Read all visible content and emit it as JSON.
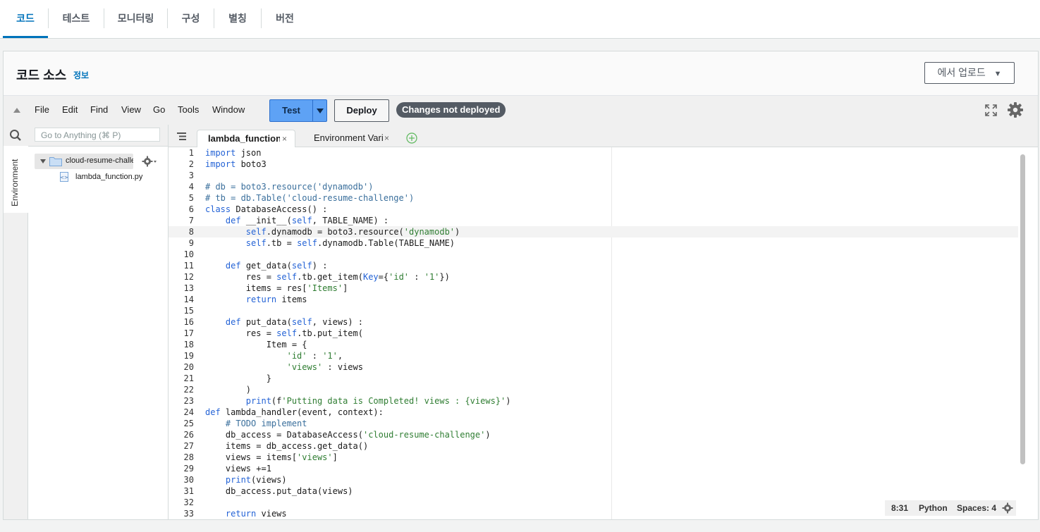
{
  "tabs": [
    "코드",
    "테스트",
    "모니터링",
    "구성",
    "별칭",
    "버전"
  ],
  "panel": {
    "title": "코드 소스",
    "info": "정보",
    "upload_label": "에서 업로드"
  },
  "menu": [
    "File",
    "Edit",
    "Find",
    "View",
    "Go",
    "Tools",
    "Window"
  ],
  "toolbar": {
    "test_label": "Test",
    "deploy_label": "Deploy",
    "status_badge": "Changes not deployed"
  },
  "sidebar": {
    "search_placeholder": "Go to Anything (⌘ P)",
    "env_label": "Environment",
    "folder": "cloud-resume-challe",
    "file": "lambda_function.py"
  },
  "editor_tabs": [
    {
      "label": "lambda_function",
      "active": true
    },
    {
      "label": "Environment Vari",
      "active": false
    }
  ],
  "code_lines": [
    "import json",
    "import boto3",
    "",
    "# db = boto3.resource('dynamodb')",
    "# tb = db.Table('cloud-resume-challenge')",
    "class DatabaseAccess() :",
    "    def __init__(self, TABLE_NAME) :",
    "        self.dynamodb = boto3.resource('dynamodb')",
    "        self.tb = self.dynamodb.Table(TABLE_NAME)",
    "",
    "    def get_data(self) :",
    "        res = self.tb.get_item(Key={'id' : '1'})",
    "        items = res['Items']",
    "        return items",
    "",
    "    def put_data(self, views) :",
    "        res = self.tb.put_item(",
    "            Item = {",
    "                'id' : '1',",
    "                'views' : views",
    "            }",
    "        )",
    "        print(f'Putting data is Completed! views : {views}')",
    "def lambda_handler(event, context):",
    "    # TODO implement",
    "    db_access = DatabaseAccess('cloud-resume-challenge')",
    "    items = db_access.get_data()",
    "    views = items['views']",
    "    views +=1",
    "    print(views)",
    "    db_access.put_data(views)",
    "",
    "    return views"
  ],
  "highlight_line": 8,
  "status_bar": {
    "position": "8:31",
    "language": "Python",
    "spaces": "Spaces: 4"
  },
  "colors": {
    "accent": "#0073bb",
    "test_button": "#5ea2f5",
    "badge": "#545b64"
  }
}
